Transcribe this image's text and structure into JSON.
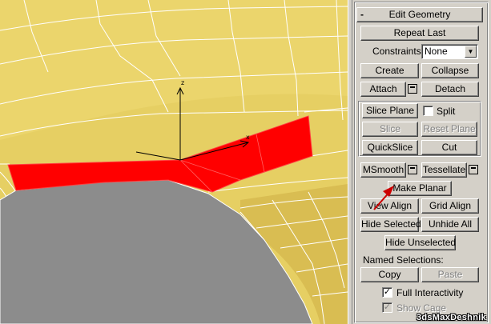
{
  "viewport": {
    "axis_z_label": "z",
    "axis_x_label": "x",
    "colors": {
      "mesh": "#e6cf63",
      "mesh_shade": "#d9bd52",
      "wire": "#ffffff",
      "selected_poly": "#ff0000",
      "hole": "#8c8c8c",
      "annotation_arrow": "#cc0000"
    }
  },
  "panel": {
    "rollout_toggle": "-",
    "rollout_title": "Edit Geometry",
    "repeat_last": "Repeat Last",
    "constraints_label": "Constraints:",
    "constraints_value": "None",
    "create": "Create",
    "collapse": "Collapse",
    "attach": "Attach",
    "detach": "Detach",
    "slice_plane": "Slice Plane",
    "split_label": "Split",
    "slice": "Slice",
    "reset_plane": "Reset Plane",
    "quickslice": "QuickSlice",
    "cut": "Cut",
    "msmooth": "MSmooth",
    "tessellate": "Tessellate",
    "make_planar": "Make Planar",
    "view_align": "View Align",
    "grid_align": "Grid Align",
    "hide_selected": "Hide Selected",
    "unhide_all": "Unhide All",
    "hide_unselected": "Hide Unselected",
    "named_selections_label": "Named Selections:",
    "copy": "Copy",
    "paste": "Paste",
    "full_interactivity_label": "Full Interactivity",
    "show_cage_label": "Show Cage",
    "checkmark": "✓"
  },
  "watermark": "3dsMaxDeshnik"
}
